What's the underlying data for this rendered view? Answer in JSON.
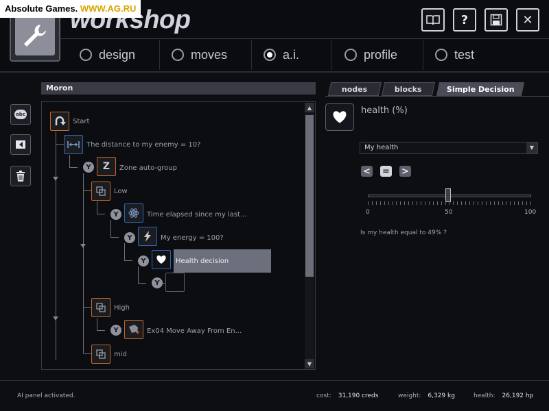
{
  "watermark": {
    "brand": "Absolute Games.",
    "site": "WWW.AG.RU"
  },
  "app": {
    "title": "workshop",
    "logo_icon": "wrench-icon"
  },
  "top_buttons": [
    {
      "icon": "book-icon",
      "label": "📖"
    },
    {
      "icon": "help-icon",
      "label": "?"
    },
    {
      "icon": "save-icon",
      "label": "💾"
    },
    {
      "icon": "close-icon",
      "label": "✕"
    }
  ],
  "nav": [
    {
      "label": "design",
      "selected": false
    },
    {
      "label": "moves",
      "selected": false
    },
    {
      "label": "a.i.",
      "selected": true
    },
    {
      "label": "profile",
      "selected": false
    },
    {
      "label": "test",
      "selected": false
    }
  ],
  "sidebar": [
    {
      "icon": "rename-icon",
      "glyph": "abc"
    },
    {
      "icon": "export-icon",
      "glyph": "⮑"
    },
    {
      "icon": "trash-icon",
      "glyph": "🗑"
    }
  ],
  "tree": {
    "title": "Moron",
    "yes_label": "Y",
    "nodes": [
      {
        "label": "Start",
        "icon": "start-icon",
        "color": "#c7672a"
      },
      {
        "label": "The distance to my enemy = 10?",
        "icon": "distance-icon",
        "color": "#2e67b6"
      },
      {
        "label": "Zone auto-group",
        "icon": "zone-icon",
        "color": "#c7672a"
      },
      {
        "label": "Low",
        "icon": "group-icon",
        "color": "#c7672a"
      },
      {
        "label": "Time elapsed since my last...",
        "icon": "atom-icon",
        "color": "#2e67b6"
      },
      {
        "label": "My energy = 100?",
        "icon": "lightning-icon",
        "color": "#2e67b6"
      },
      {
        "label": "Health decision",
        "icon": "heart-icon",
        "color": "#2e67b6",
        "selected": true
      },
      {
        "label": "",
        "icon": "empty-slot-icon",
        "color": "#5a5d68"
      },
      {
        "label": "High",
        "icon": "group-icon",
        "color": "#c7672a"
      },
      {
        "label": "Ex04 Move Away From En...",
        "icon": "move-icon",
        "color": "#c7672a"
      },
      {
        "label": "mid",
        "icon": "group-icon",
        "color": "#c7672a"
      }
    ]
  },
  "tabs": [
    {
      "label": "nodes",
      "active": false
    },
    {
      "label": "blocks",
      "active": false
    },
    {
      "label": "Simple Decision",
      "active": true
    }
  ],
  "decision": {
    "icon": "heart-icon",
    "title": "health (%)",
    "dropdown_value": "My health",
    "operators": [
      {
        "label": "<",
        "selected": false
      },
      {
        "label": "=",
        "selected": true
      },
      {
        "label": ">",
        "selected": false
      }
    ],
    "slider": {
      "min": 0,
      "max": 100,
      "value": 49,
      "labels": [
        "0",
        "50",
        "100"
      ]
    },
    "question": "Is my health equal to 49% ?"
  },
  "status": {
    "message": "AI panel activated.",
    "cost_label": "cost:",
    "cost_value": "31,190 creds",
    "weight_label": "weight:",
    "weight_value": "6,329 kg",
    "health_label": "health:",
    "health_value": "26,192 hp"
  },
  "colors": {
    "accent_orange": "#c7672a",
    "accent_blue": "#2e67b6",
    "selected_row": "#6c6f7c"
  }
}
